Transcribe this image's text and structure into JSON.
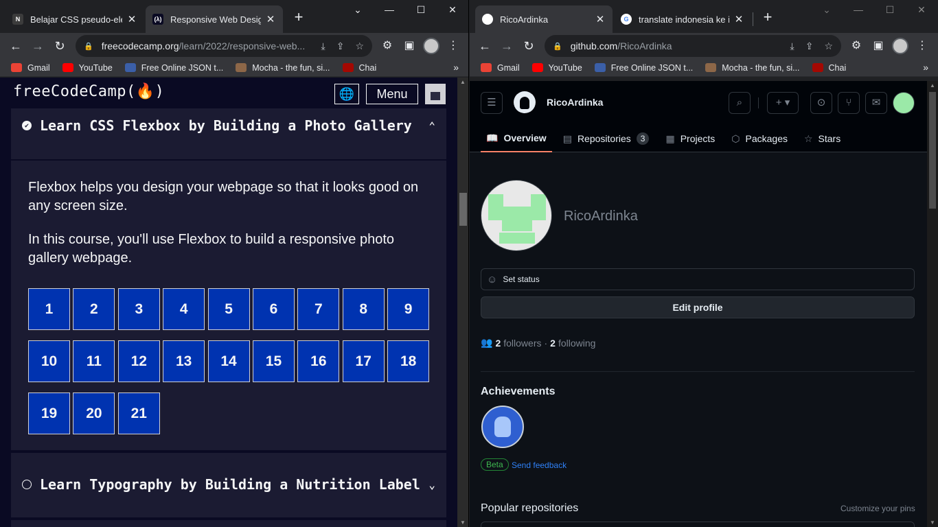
{
  "left": {
    "tabs": [
      {
        "title": "Belajar CSS pseudo-eleme",
        "favicon": "N"
      },
      {
        "title": "Responsive Web Design C",
        "favicon": "(λ)"
      }
    ],
    "url_host": "freecodecamp.org",
    "url_path": "/learn/2022/responsive-web...",
    "bookmarks": [
      "Gmail",
      "YouTube",
      "Free Online JSON t...",
      "Mocha - the fun, si...",
      "Chai"
    ],
    "fcc": {
      "logo": "freeCodeCamp(🔥)",
      "menu_label": "Menu",
      "block1_title": "Learn CSS Flexbox by Building a Photo Gallery",
      "desc1": "Flexbox helps you design your webpage so that it looks good on any screen size.",
      "desc2": "In this course, you'll use Flexbox to build a responsive photo gallery webpage.",
      "steps": [
        "1",
        "2",
        "3",
        "4",
        "5",
        "6",
        "7",
        "8",
        "9",
        "10",
        "11",
        "12",
        "13",
        "14",
        "15",
        "16",
        "17",
        "18",
        "19",
        "20",
        "21"
      ],
      "block2_title": "Learn Typography by Building a Nutrition Label"
    }
  },
  "right": {
    "tabs": [
      {
        "title": "RicoArdinka"
      },
      {
        "title": "translate indonesia ke ing"
      }
    ],
    "url_host": "github.com",
    "url_path": "/RicoArdinka",
    "bookmarks": [
      "Gmail",
      "YouTube",
      "Free Online JSON t...",
      "Mocha - the fun, si...",
      "Chai"
    ],
    "gh": {
      "username": "RicoArdinka",
      "tabs": [
        {
          "label": "Overview",
          "icon": "book-icon"
        },
        {
          "label": "Repositories",
          "icon": "repo-icon",
          "count": "3"
        },
        {
          "label": "Projects",
          "icon": "table-icon"
        },
        {
          "label": "Packages",
          "icon": "package-icon"
        },
        {
          "label": "Stars",
          "icon": "star-icon"
        }
      ],
      "display_name": "RicoArdinka",
      "set_status": "Set status",
      "edit_profile": "Edit profile",
      "followers_count": "2",
      "followers_label": "followers",
      "following_count": "2",
      "following_label": "following",
      "achievements_title": "Achievements",
      "beta_label": "Beta",
      "send_feedback": "Send feedback",
      "popular_title": "Popular repositories",
      "customize_pins": "Customize your pins"
    }
  }
}
